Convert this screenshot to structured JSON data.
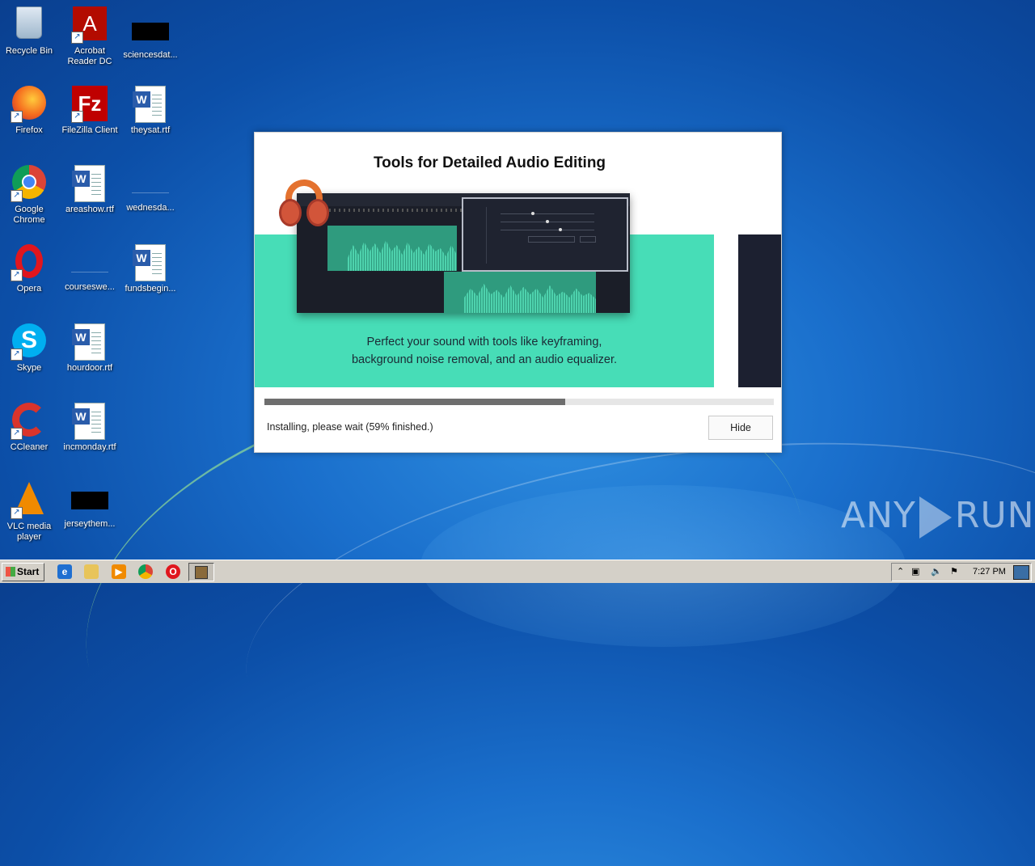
{
  "desktop": {
    "icons": [
      {
        "label": "Recycle Bin"
      },
      {
        "label": "Acrobat Reader DC"
      },
      {
        "label": "sciencesdat..."
      },
      {
        "label": "Firefox"
      },
      {
        "label": "FileZilla Client"
      },
      {
        "label": "theysat.rtf"
      },
      {
        "label": "Google Chrome"
      },
      {
        "label": "areashow.rtf"
      },
      {
        "label": "wednesda..."
      },
      {
        "label": "Opera"
      },
      {
        "label": "courseswe..."
      },
      {
        "label": "fundsbegin..."
      },
      {
        "label": "Skype"
      },
      {
        "label": "hourdoor.rtf"
      },
      {
        "label": "CCleaner"
      },
      {
        "label": "incmonday.rtf"
      },
      {
        "label": "VLC media player"
      },
      {
        "label": "jerseythem..."
      }
    ]
  },
  "installer": {
    "slide_title": "Tools for Detailed Audio Editing",
    "slide_text_line1": "Perfect your sound with tools like keyframing,",
    "slide_text_line2": "background noise removal, and an audio equalizer.",
    "progress_percent": 59,
    "status": "Installing, please wait (59% finished.)",
    "hide_label": "Hide",
    "accent_color": "#47ddb7"
  },
  "watermark": {
    "text_left": "ANY",
    "text_right": "RUN"
  },
  "taskbar": {
    "start_label": "Start",
    "clock": "7:27 PM",
    "quicklaunch": [
      "ie-icon",
      "explorer-icon",
      "media-player-icon",
      "chrome-icon",
      "opera-icon"
    ]
  }
}
